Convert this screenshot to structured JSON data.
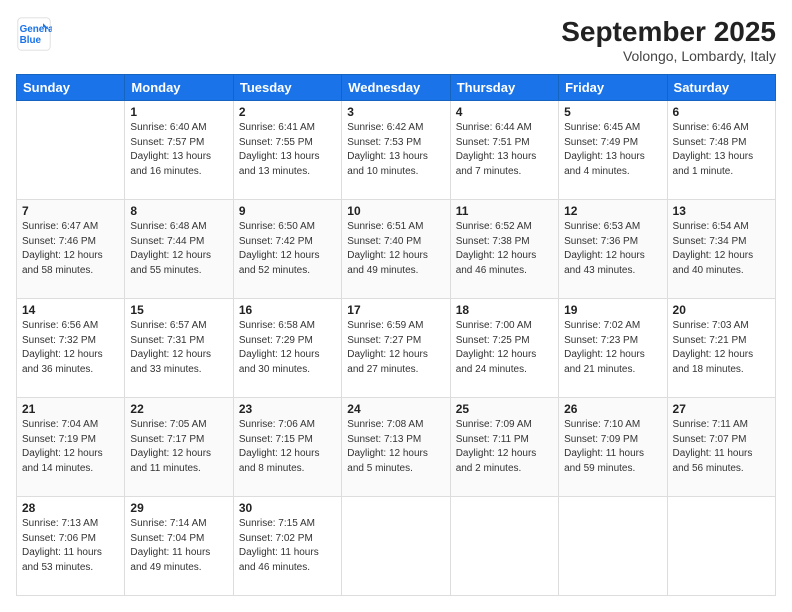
{
  "logo": {
    "line1": "General",
    "line2": "Blue"
  },
  "title": "September 2025",
  "location": "Volongo, Lombardy, Italy",
  "days_of_week": [
    "Sunday",
    "Monday",
    "Tuesday",
    "Wednesday",
    "Thursday",
    "Friday",
    "Saturday"
  ],
  "weeks": [
    [
      {
        "day": "",
        "info": ""
      },
      {
        "day": "1",
        "info": "Sunrise: 6:40 AM\nSunset: 7:57 PM\nDaylight: 13 hours\nand 16 minutes."
      },
      {
        "day": "2",
        "info": "Sunrise: 6:41 AM\nSunset: 7:55 PM\nDaylight: 13 hours\nand 13 minutes."
      },
      {
        "day": "3",
        "info": "Sunrise: 6:42 AM\nSunset: 7:53 PM\nDaylight: 13 hours\nand 10 minutes."
      },
      {
        "day": "4",
        "info": "Sunrise: 6:44 AM\nSunset: 7:51 PM\nDaylight: 13 hours\nand 7 minutes."
      },
      {
        "day": "5",
        "info": "Sunrise: 6:45 AM\nSunset: 7:49 PM\nDaylight: 13 hours\nand 4 minutes."
      },
      {
        "day": "6",
        "info": "Sunrise: 6:46 AM\nSunset: 7:48 PM\nDaylight: 13 hours\nand 1 minute."
      }
    ],
    [
      {
        "day": "7",
        "info": "Sunrise: 6:47 AM\nSunset: 7:46 PM\nDaylight: 12 hours\nand 58 minutes."
      },
      {
        "day": "8",
        "info": "Sunrise: 6:48 AM\nSunset: 7:44 PM\nDaylight: 12 hours\nand 55 minutes."
      },
      {
        "day": "9",
        "info": "Sunrise: 6:50 AM\nSunset: 7:42 PM\nDaylight: 12 hours\nand 52 minutes."
      },
      {
        "day": "10",
        "info": "Sunrise: 6:51 AM\nSunset: 7:40 PM\nDaylight: 12 hours\nand 49 minutes."
      },
      {
        "day": "11",
        "info": "Sunrise: 6:52 AM\nSunset: 7:38 PM\nDaylight: 12 hours\nand 46 minutes."
      },
      {
        "day": "12",
        "info": "Sunrise: 6:53 AM\nSunset: 7:36 PM\nDaylight: 12 hours\nand 43 minutes."
      },
      {
        "day": "13",
        "info": "Sunrise: 6:54 AM\nSunset: 7:34 PM\nDaylight: 12 hours\nand 40 minutes."
      }
    ],
    [
      {
        "day": "14",
        "info": "Sunrise: 6:56 AM\nSunset: 7:32 PM\nDaylight: 12 hours\nand 36 minutes."
      },
      {
        "day": "15",
        "info": "Sunrise: 6:57 AM\nSunset: 7:31 PM\nDaylight: 12 hours\nand 33 minutes."
      },
      {
        "day": "16",
        "info": "Sunrise: 6:58 AM\nSunset: 7:29 PM\nDaylight: 12 hours\nand 30 minutes."
      },
      {
        "day": "17",
        "info": "Sunrise: 6:59 AM\nSunset: 7:27 PM\nDaylight: 12 hours\nand 27 minutes."
      },
      {
        "day": "18",
        "info": "Sunrise: 7:00 AM\nSunset: 7:25 PM\nDaylight: 12 hours\nand 24 minutes."
      },
      {
        "day": "19",
        "info": "Sunrise: 7:02 AM\nSunset: 7:23 PM\nDaylight: 12 hours\nand 21 minutes."
      },
      {
        "day": "20",
        "info": "Sunrise: 7:03 AM\nSunset: 7:21 PM\nDaylight: 12 hours\nand 18 minutes."
      }
    ],
    [
      {
        "day": "21",
        "info": "Sunrise: 7:04 AM\nSunset: 7:19 PM\nDaylight: 12 hours\nand 14 minutes."
      },
      {
        "day": "22",
        "info": "Sunrise: 7:05 AM\nSunset: 7:17 PM\nDaylight: 12 hours\nand 11 minutes."
      },
      {
        "day": "23",
        "info": "Sunrise: 7:06 AM\nSunset: 7:15 PM\nDaylight: 12 hours\nand 8 minutes."
      },
      {
        "day": "24",
        "info": "Sunrise: 7:08 AM\nSunset: 7:13 PM\nDaylight: 12 hours\nand 5 minutes."
      },
      {
        "day": "25",
        "info": "Sunrise: 7:09 AM\nSunset: 7:11 PM\nDaylight: 12 hours\nand 2 minutes."
      },
      {
        "day": "26",
        "info": "Sunrise: 7:10 AM\nSunset: 7:09 PM\nDaylight: 11 hours\nand 59 minutes."
      },
      {
        "day": "27",
        "info": "Sunrise: 7:11 AM\nSunset: 7:07 PM\nDaylight: 11 hours\nand 56 minutes."
      }
    ],
    [
      {
        "day": "28",
        "info": "Sunrise: 7:13 AM\nSunset: 7:06 PM\nDaylight: 11 hours\nand 53 minutes."
      },
      {
        "day": "29",
        "info": "Sunrise: 7:14 AM\nSunset: 7:04 PM\nDaylight: 11 hours\nand 49 minutes."
      },
      {
        "day": "30",
        "info": "Sunrise: 7:15 AM\nSunset: 7:02 PM\nDaylight: 11 hours\nand 46 minutes."
      },
      {
        "day": "",
        "info": ""
      },
      {
        "day": "",
        "info": ""
      },
      {
        "day": "",
        "info": ""
      },
      {
        "day": "",
        "info": ""
      }
    ]
  ]
}
